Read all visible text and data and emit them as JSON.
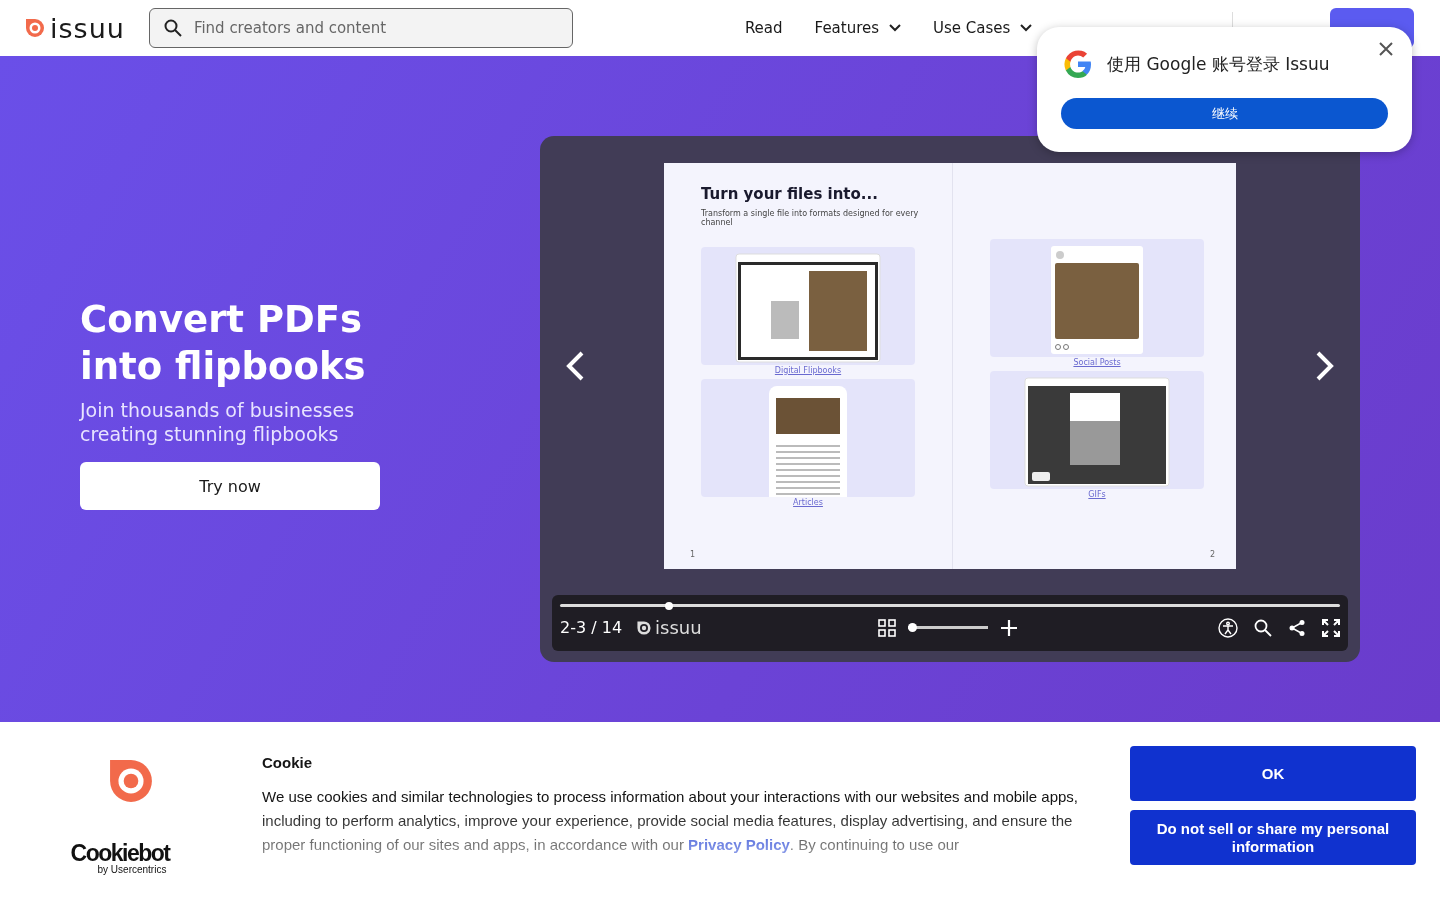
{
  "header": {
    "logo": "issuu",
    "search": {
      "placeholder": "Find creators and content"
    },
    "nav": [
      {
        "label": "Read",
        "kind": "link"
      },
      {
        "label": "Features",
        "kind": "dropdown"
      },
      {
        "label": "Use Cases",
        "kind": "dropdown"
      }
    ]
  },
  "hero": {
    "title": "Convert PDFs into flipbooks",
    "subtitle": "Join thousands of businesses creating stunning flipbooks",
    "cta": "Try now"
  },
  "viewer": {
    "pages": [
      {
        "title": "Turn your files into...",
        "subtitle": "Transform a single file into formats designed for every channel",
        "page_number": "1",
        "cards": [
          {
            "label": "Digital Flipbooks",
            "kind": "tablet"
          },
          {
            "label": "Articles",
            "kind": "phone"
          }
        ]
      },
      {
        "page_number": "2",
        "cards": [
          {
            "label": "Social Posts",
            "kind": "post"
          },
          {
            "label": "GIFs",
            "kind": "gif"
          }
        ]
      }
    ],
    "progress": {
      "level": 0.14
    },
    "page_indicator": "2-3 / 14",
    "brand": "issuu",
    "zoom": {
      "level": 0
    }
  },
  "google_prompt": {
    "title": "使用 Google 账号登录 Issuu",
    "button": "继续"
  },
  "cookie_banner": {
    "brand": "Cookiebot",
    "brand_sub": "by Usercentrics",
    "title": "Cookie",
    "text_before": "We use cookies and similar technologies to process information about your interactions with our websites and mobile apps, including to perform analytics, improve your experience, provide social media features, display advertising, and ensure the proper functioning of our sites and apps, in accordance with our ",
    "link": "Privacy Policy",
    "text_after": ". By continuing to use our",
    "buttons": [
      "OK",
      "Do not sell or share my personal information"
    ]
  }
}
